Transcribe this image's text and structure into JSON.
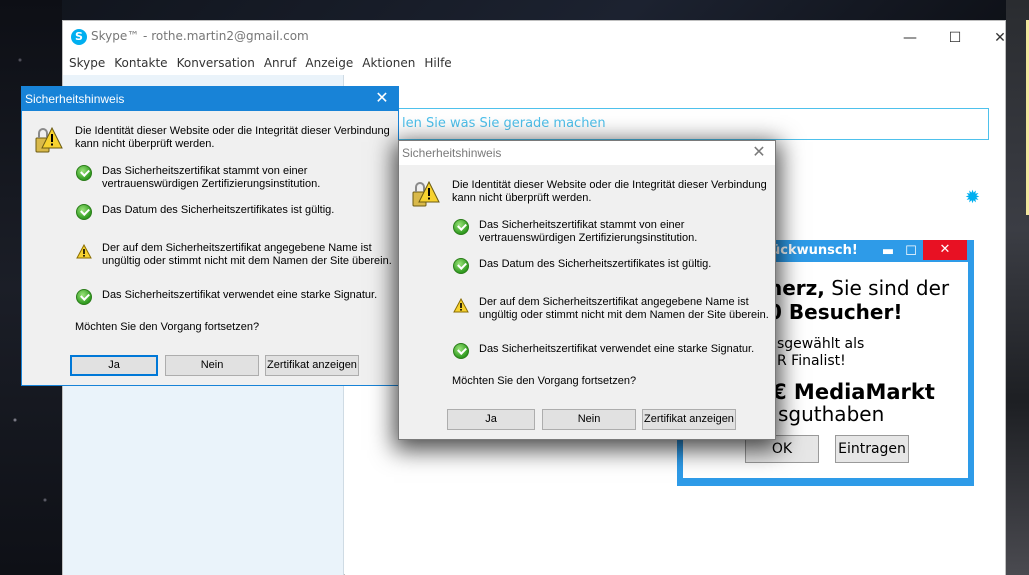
{
  "skype": {
    "title": "Skype™ - rothe.martin2@gmail.com",
    "logo_letter": "S",
    "window_controls": {
      "minimize": "—",
      "maximize": "☐",
      "close": "✕"
    },
    "menu": [
      "Skype",
      "Kontakte",
      "Konversation",
      "Anruf",
      "Anzeige",
      "Aktionen",
      "Hilfe"
    ],
    "mood_placeholder": "len Sie was Sie gerade machen",
    "gear_icon": "gear-icon"
  },
  "ad": {
    "title": "ückwunsch!",
    "min": "▬",
    "max": "☐",
    "close": "✕",
    "line1_bold": "herz,",
    "line1_rest": " Sie sind der",
    "line2": "0 Besucher!",
    "line3": "sgewählt als",
    "line4": "R Finalist!",
    "line5": "€ MediaMarkt",
    "line6": "sguthaben",
    "ok_label": "OK",
    "register_label": "Eintragen"
  },
  "dialog": {
    "title": "Sicherheitshinweis",
    "close": "✕",
    "intro_line1": "Die Identität dieser Website oder die Integrität dieser Verbindung",
    "intro_line2": "kann nicht überprüft werden.",
    "items": [
      {
        "status": "ok",
        "line1": "Das Sicherheitszertifikat stammt von einer",
        "line2": "vertrauenswürdigen Zertifizierungsinstitution."
      },
      {
        "status": "ok",
        "line1": "Das Datum des Sicherheitszertifikates ist gültig.",
        "line2": ""
      },
      {
        "status": "warning",
        "line1": "Der auf dem Sicherheitszertifikat angegebene Name ist",
        "line2": "ungültig oder stimmt nicht mit dem Namen der Site überein."
      },
      {
        "status": "ok",
        "line1": "Das Sicherheitszertifikat verwendet eine starke Signatur.",
        "line2": ""
      }
    ],
    "question": "Möchten Sie den Vorgang fortsetzen?",
    "buttons": {
      "yes": "Ja",
      "no": "Nein",
      "view": "Zertifikat anzeigen"
    }
  }
}
